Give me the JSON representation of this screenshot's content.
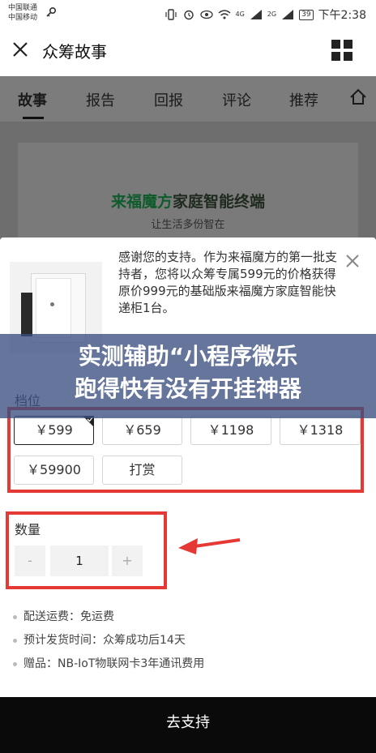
{
  "status_bar": {
    "carrier_1": "中国联通",
    "carrier_2": "中国移动",
    "signal_1": "4G",
    "signal_2": "2G",
    "battery": "39",
    "time": "下午2:38"
  },
  "appbar": {
    "title": "众筹故事"
  },
  "tabs": [
    {
      "label": "故事"
    },
    {
      "label": "报告"
    },
    {
      "label": "回报"
    },
    {
      "label": "评论"
    },
    {
      "label": "推荐"
    }
  ],
  "banner": {
    "brand": "来福魔方",
    "title_rest": "家庭智能终端",
    "subtitle": "让生活多份智在"
  },
  "sheet": {
    "description": "感谢您的支持。作为来福魔方的第一批支持者，您将以众筹专属599元的价格获得原价999元的基础版来福魔方家庭智能快递柜1台。",
    "tier_label": "档位",
    "options": [
      {
        "label": "￥599",
        "selected": true
      },
      {
        "label": "￥659",
        "selected": false
      },
      {
        "label": "￥1198",
        "selected": false
      },
      {
        "label": "￥1318",
        "selected": false
      },
      {
        "label": "￥59900",
        "selected": false
      },
      {
        "label": "打赏",
        "selected": false
      }
    ],
    "quantity_label": "数量",
    "quantity_minus": "-",
    "quantity_value": "1",
    "quantity_plus": "+",
    "info": [
      "配送运费：免运费",
      "预计发货时间：众筹成功后14天",
      "赠品：NB-IoT物联网卡3年通讯费用"
    ],
    "submit_label": "去支持"
  },
  "overlay": {
    "line_1": "实测辅助“小程序微乐",
    "line_2": "跑得快有没有开挂神器"
  },
  "colors": {
    "highlight_red": "#e53935",
    "overlay_blue": "#3a4e80"
  }
}
